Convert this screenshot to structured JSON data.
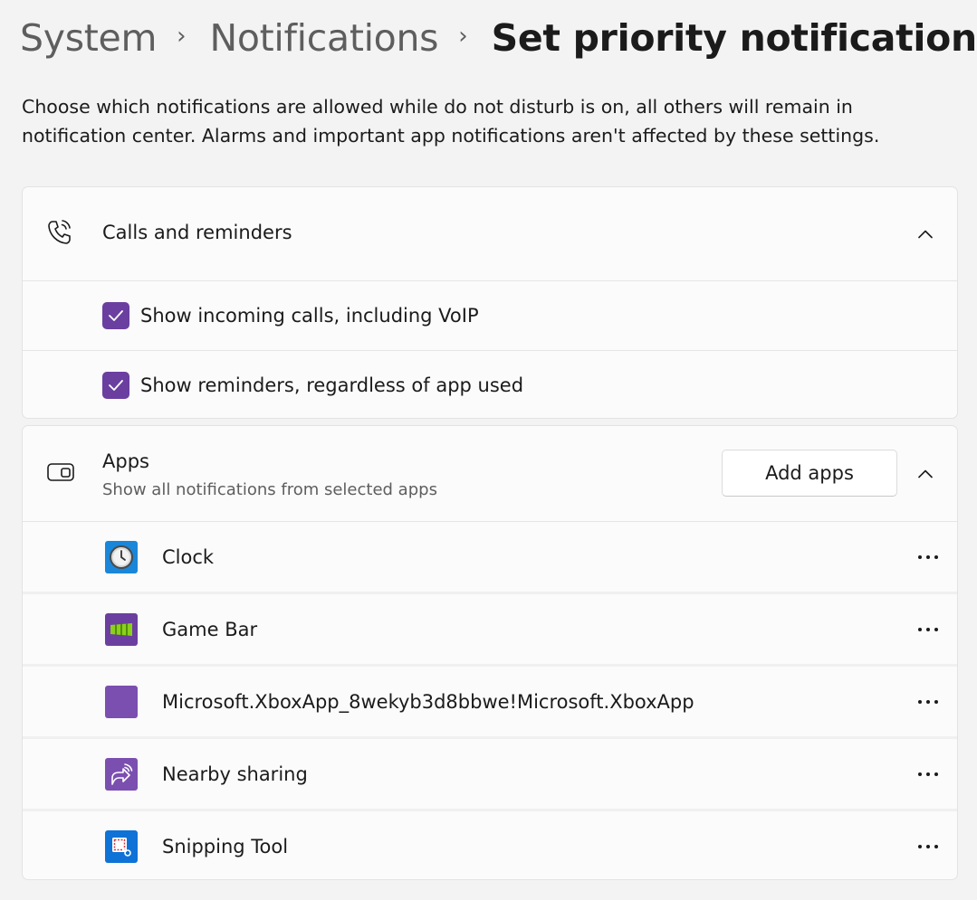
{
  "breadcrumb": {
    "items": [
      "System",
      "Notifications",
      "Set priority notifications"
    ],
    "separator": "›"
  },
  "description": "Choose which notifications are allowed while do not disturb is on, all others will remain in notification center. Alarms and important app notifications aren't affected by these settings.",
  "calls_section": {
    "icon": "phone-ringing-icon",
    "title": "Calls and reminders",
    "expanded": true,
    "options": [
      {
        "label": "Show incoming calls, including VoIP",
        "checked": true
      },
      {
        "label": "Show reminders, regardless of app used",
        "checked": true
      }
    ]
  },
  "apps_section": {
    "icon": "app-window-icon",
    "title": "Apps",
    "subtitle": "Show all notifications from selected apps",
    "add_button": "Add apps",
    "expanded": true,
    "apps": [
      {
        "name": "Clock",
        "icon": "clock-app-icon"
      },
      {
        "name": "Game Bar",
        "icon": "game-bar-app-icon"
      },
      {
        "name": "Microsoft.XboxApp_8wekyb3d8bbwe!Microsoft.XboxApp",
        "icon": "xbox-app-icon"
      },
      {
        "name": "Nearby sharing",
        "icon": "nearby-sharing-app-icon"
      },
      {
        "name": "Snipping Tool",
        "icon": "snipping-tool-app-icon"
      }
    ]
  },
  "colors": {
    "accent": "#6b3fa0",
    "background": "#f3f3f3",
    "card": "#fbfbfb",
    "xbox_purple": "#7b4fb0",
    "clock_blue": "#1a86d9",
    "snipping_blue": "#0f72d6"
  }
}
